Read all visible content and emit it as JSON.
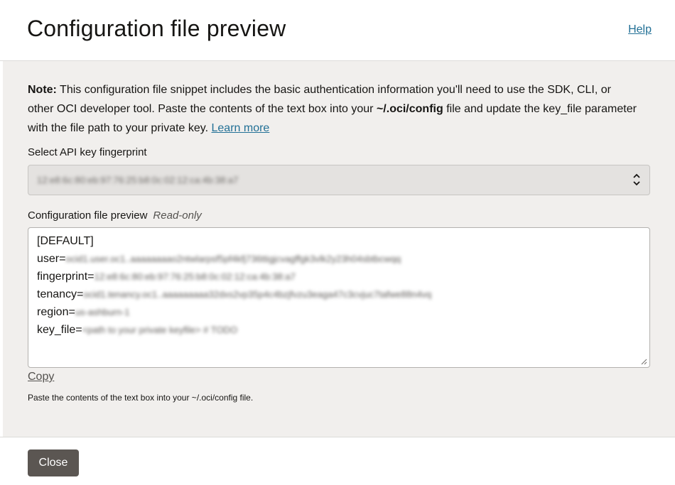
{
  "header": {
    "title": "Configuration file preview",
    "help_label": "Help"
  },
  "note": {
    "bold_label": "Note:",
    "text": " This configuration file snippet includes the basic authentication information you'll need to use the SDK, CLI, or other OCI developer tool. Paste the contents of the text box into your ",
    "path": "~/.oci/config",
    "text_after": " file and update the key_file parameter with the file path to your private key. ",
    "learn_more_label": "Learn more"
  },
  "fingerprint_select": {
    "label": "Select API key fingerprint",
    "value": "12:e8:6c:80:eb:97:76:25:b8:0c:02:12:ca:4b:38:a7"
  },
  "config_preview": {
    "label": "Configuration file preview",
    "readonly_label": "Read-only",
    "lines": [
      {
        "key": "[DEFAULT]",
        "value": ""
      },
      {
        "key": "user=",
        "value": "ocid1.user.oc1..aaaaaaaao2ntwlarpsf5pf4kfj736ttigjcvagffgk3vlk2y23h04sbtbcwqq"
      },
      {
        "key": "fingerprint=",
        "value": "12:e8:6c:80:eb:97:76:25:b8:0c:02:12:ca:4b:38:a7"
      },
      {
        "key": "tenancy=",
        "value": "ocid1.tenancy.oc1..aaaaaaaaa32dxs2vp35p4c4bzjfvzu3eaga47c3cvjuc7tafwe88n4vq"
      },
      {
        "key": "region=",
        "value": "us-ashburn-1"
      },
      {
        "key": "key_file=",
        "value": "<path to your private keyfile> # TODO"
      }
    ]
  },
  "copy_label": "Copy",
  "hint": "Paste the contents of the text box into your ~/.oci/config file.",
  "footer": {
    "close_label": "Close"
  }
}
